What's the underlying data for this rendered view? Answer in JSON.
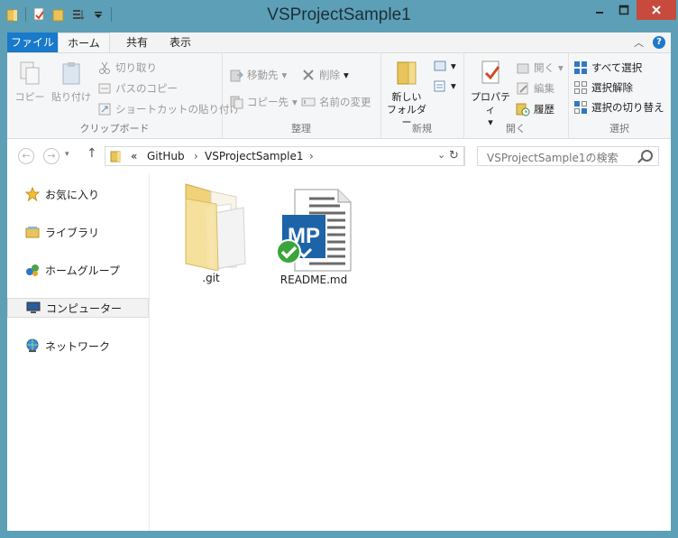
{
  "window": {
    "title": "VSProjectSample1"
  },
  "ribbon_tabs": [
    "ファイル",
    "ホーム",
    "共有",
    "表示"
  ],
  "ribbon": {
    "clipboard": {
      "copy": "コピー",
      "paste": "貼り付け",
      "cut": "切り取り",
      "copy_path": "パスのコピー",
      "paste_shortcut": "ショートカットの貼り付け",
      "label": "クリップボード"
    },
    "organize": {
      "move_to": "移動先",
      "copy_to": "コピー先",
      "delete": "削除",
      "rename": "名前の変更",
      "label": "整理"
    },
    "new": {
      "new_folder_line1": "新しい",
      "new_folder_line2": "フォルダー",
      "label": "新規"
    },
    "open": {
      "properties": "プロパティ",
      "open": "開く",
      "edit": "編集",
      "history": "履歴",
      "label": "開く"
    },
    "select": {
      "select_all": "すべて選択",
      "select_none": "選択解除",
      "invert": "選択の切り替え",
      "label": "選択"
    }
  },
  "address": {
    "overflow": "«",
    "crumbs": [
      "GitHub",
      "VSProjectSample1"
    ]
  },
  "search": {
    "placeholder": "VSProjectSample1の検索"
  },
  "navpane": {
    "items": [
      "お気に入り",
      "ライブラリ",
      "ホームグループ",
      "コンピューター",
      "ネットワーク"
    ],
    "selected": "コンピューター"
  },
  "files": [
    {
      "name": ".git",
      "icon": "folder-icon"
    },
    {
      "name": "README.md",
      "icon": "markdownpad-icon",
      "badge": "sync-ok-icon",
      "logo_text": "MP"
    }
  ],
  "colors": {
    "frame": "#5c9fb7",
    "file_tab": "#1979ca",
    "close": "#c74a3c",
    "mp_blue": "#1d63a8",
    "check_green": "#3aa63a"
  }
}
